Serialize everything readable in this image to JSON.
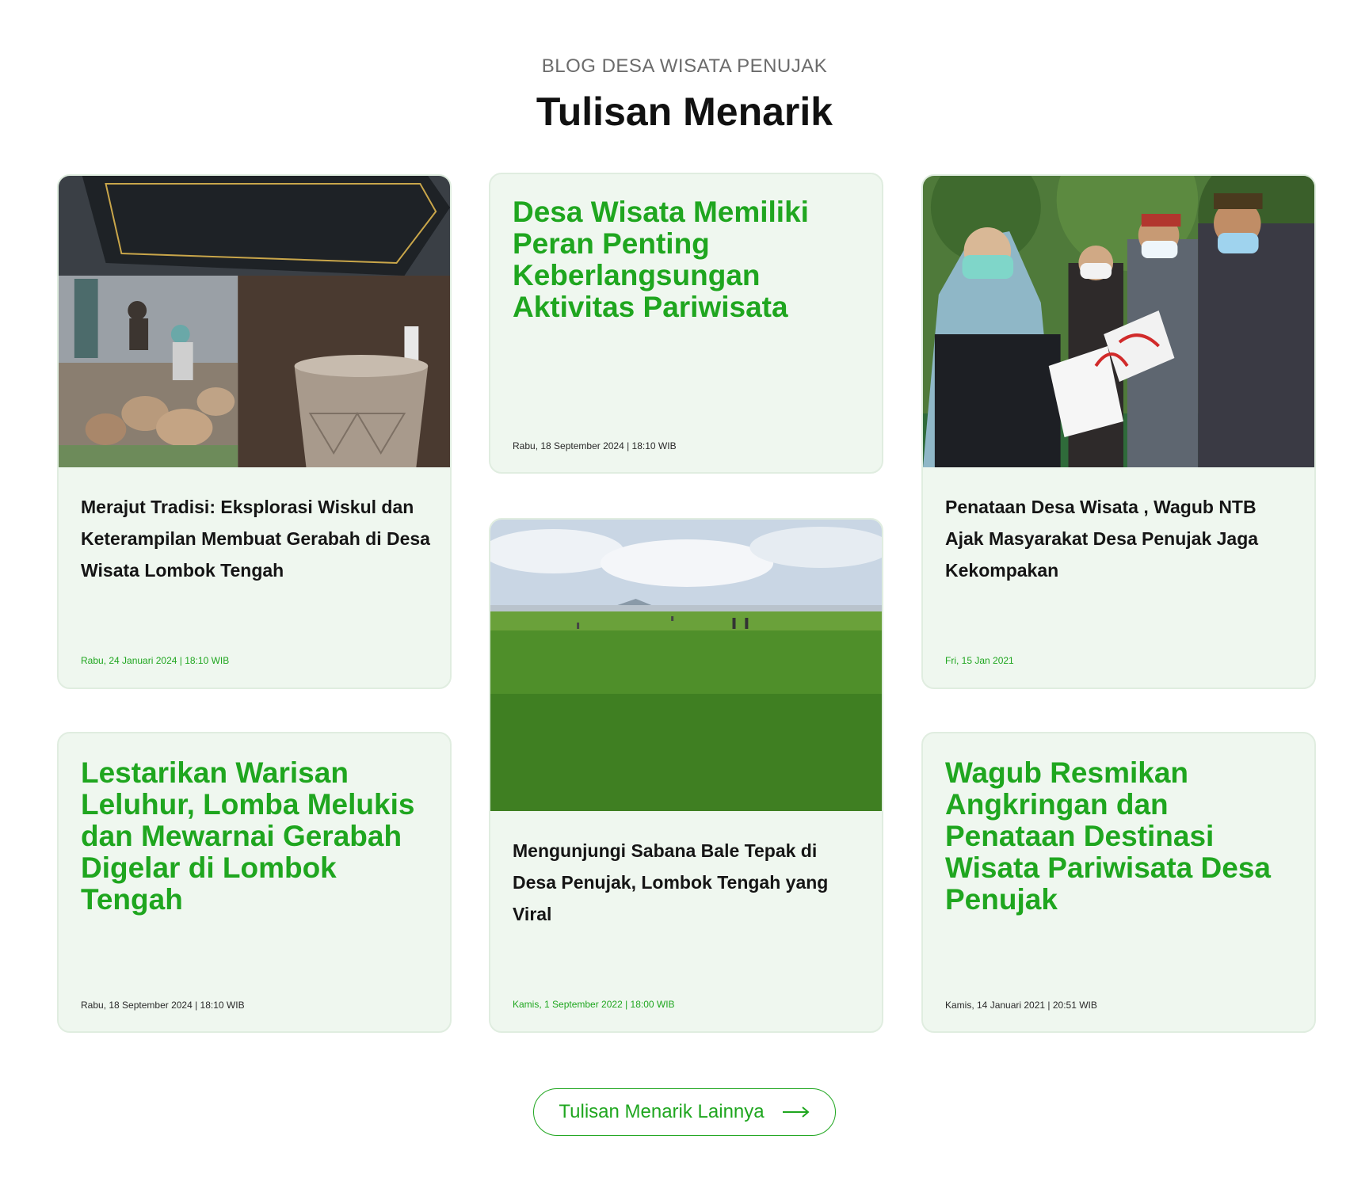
{
  "section": {
    "eyebrow": "BLOG DESA WISATA PENUJAK",
    "title": "Tulisan Menarik"
  },
  "cards": [
    {
      "headline": "Merajut Tradisi: Eksplorasi Wiskul dan Keterampilan Membuat Gerabah di Desa Wisata Lombok Tengah",
      "date": "Rabu, 24 Januari 2024 | 18:10 WIB",
      "has_image": true,
      "date_color": "#1fa61f"
    },
    {
      "headline": "Desa Wisata Memiliki Peran Penting Keberlangsungan Aktivitas Pariwisata",
      "date": "Rabu, 18 September  2024 | 18:10 WIB",
      "has_image": false,
      "date_color": "#2a2a2a"
    },
    {
      "headline": "Penataan Desa Wisata , Wagub NTB Ajak Masyarakat Desa Penujak Jaga Kekompakan",
      "date": "Fri, 15 Jan 2021",
      "has_image": true,
      "date_color": "#1fa61f"
    },
    {
      "headline": "Lestarikan Warisan Leluhur, Lomba Melukis dan Mewarnai Gerabah Digelar di Lombok Tengah",
      "date": "Rabu, 18 September  2024 | 18:10 WIB",
      "has_image": false,
      "date_color": "#2a2a2a"
    },
    {
      "headline": "Mengunjungi Sabana Bale Tepak di Desa Penujak, Lombok Tengah yang Viral",
      "date": "Kamis, 1 September 2022 | 18:00 WIB",
      "has_image": true,
      "date_color": "#1fa61f"
    },
    {
      "headline": "Wagub Resmikan Angkringan dan Penataan Destinasi Wisata Pariwisata Desa Penujak",
      "date": "Kamis, 14 Januari 2021 | 20:51 WIB",
      "has_image": false,
      "date_color": "#2a2a2a"
    }
  ],
  "more_button": {
    "label": "Tulisan Menarik Lainnya",
    "icon": "arrow-right-icon"
  },
  "colors": {
    "accent": "#1fa61f",
    "card_bg": "#eff7ef",
    "card_border": "#e0ede0",
    "text_dark": "#111111",
    "eyebrow": "#6b6b6b"
  }
}
